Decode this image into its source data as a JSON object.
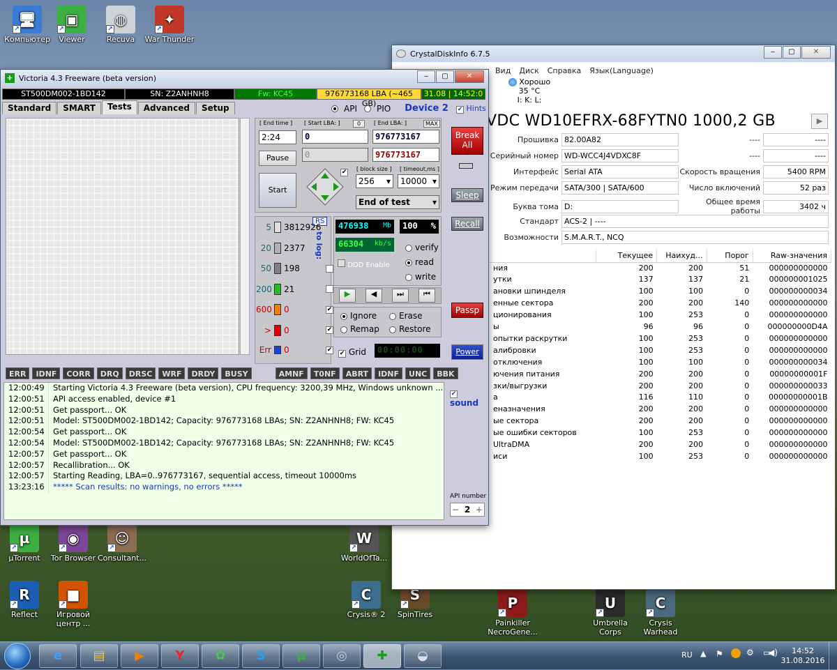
{
  "desktop_icons": [
    {
      "label": "Компьютер",
      "color": "#3a7bd5",
      "glyph": "🖥"
    },
    {
      "label": "Viewer",
      "color": "#3cb043",
      "glyph": "▣"
    },
    {
      "label": "Recuva",
      "color": "#cfd3d8",
      "glyph": "◍"
    },
    {
      "label": "War Thunder",
      "color": "#c0392b",
      "glyph": "✦"
    },
    {
      "label": "µTorrent",
      "color": "#3cb043",
      "glyph": "µ"
    },
    {
      "label": "Tor Browser",
      "color": "#7d4698",
      "glyph": "◉"
    },
    {
      "label": "Consultant...",
      "color": "#8c6d52",
      "glyph": "☺"
    },
    {
      "label": "WorldOfTa...",
      "color": "#555",
      "glyph": "W"
    },
    {
      "label": "Reflect",
      "color": "#1a5fb4",
      "glyph": "R"
    },
    {
      "label": "Игровой центр ...",
      "color": "#d35400",
      "glyph": "■"
    },
    {
      "label": "Crysis® 2",
      "color": "#3b6e8f",
      "glyph": "C"
    },
    {
      "label": "SpinTires",
      "color": "#6b4a2a",
      "glyph": "S"
    },
    {
      "label": "Painkiller NecroGene...",
      "color": "#8e1b1b",
      "glyph": "P"
    },
    {
      "label": "Umbrella Corps",
      "color": "#2b2b2b",
      "glyph": "U"
    },
    {
      "label": "Crysis Warhead",
      "color": "#4a6a7f",
      "glyph": "C"
    }
  ],
  "crystal": {
    "title": "CrystalDiskInfo 6.7.5",
    "menu": [
      "Вид",
      "Диск",
      "Справка",
      "Язык(Language)"
    ],
    "health": "Хорошо",
    "temp": "35 °C",
    "drives": "I: K: L:",
    "model": "VDC WD10EFRX-68FYTN0 1000,2 GB",
    "fields": [
      {
        "label": "Прошивка",
        "value": "82.00A82",
        "rlabel": "----",
        "rvalue": "----"
      },
      {
        "label": "Серийный номер",
        "value": "WD-WCC4J4VDXC8F",
        "rlabel": "----",
        "rvalue": "----"
      },
      {
        "label": "Интерфейс",
        "value": "Serial ATA",
        "rlabel": "Скорость вращения",
        "rvalue": "5400 RPM"
      },
      {
        "label": "Режим передачи",
        "value": "SATA/300 | SATA/600",
        "rlabel": "Число включений",
        "rvalue": "52 раз"
      },
      {
        "label": "Буква тома",
        "value": "D:",
        "rlabel": "Общее время работы",
        "rvalue": "3402 ч"
      }
    ],
    "standard_label": "Стандарт",
    "standard": "ACS-2 | ----",
    "features_label": "Возможности",
    "features": "S.M.A.R.T., NCQ",
    "table_headers": [
      "",
      "Текущее",
      "Наихуд...",
      "Порог",
      "Raw-значения"
    ],
    "table_rows": [
      [
        "ния",
        "200",
        "200",
        "51",
        "000000000000"
      ],
      [
        "утки",
        "137",
        "137",
        "21",
        "000000001025"
      ],
      [
        "ановки шпинделя",
        "100",
        "100",
        "0",
        "000000000034"
      ],
      [
        "енные сектора",
        "200",
        "200",
        "140",
        "000000000000"
      ],
      [
        "ционирования",
        "100",
        "253",
        "0",
        "000000000000"
      ],
      [
        "ы",
        "96",
        "96",
        "0",
        "000000000D4A"
      ],
      [
        "опытки раскрутки",
        "100",
        "253",
        "0",
        "000000000000"
      ],
      [
        "алибровки",
        "100",
        "253",
        "0",
        "000000000000"
      ],
      [
        "отключения",
        "100",
        "100",
        "0",
        "000000000034"
      ],
      [
        "ючения питания",
        "200",
        "200",
        "0",
        "00000000001F"
      ],
      [
        "зки/выгрузки",
        "200",
        "200",
        "0",
        "000000000033"
      ],
      [
        "а",
        "116",
        "110",
        "0",
        "00000000001B"
      ],
      [
        "еназначения",
        "200",
        "200",
        "0",
        "000000000000"
      ],
      [
        "ые сектора",
        "200",
        "200",
        "0",
        "000000000000"
      ],
      [
        "ые ошибки секторов",
        "100",
        "253",
        "0",
        "000000000000"
      ],
      [
        "UltraDMA",
        "200",
        "200",
        "0",
        "000000000000"
      ],
      [
        "иси",
        "100",
        "253",
        "0",
        "000000000000"
      ]
    ]
  },
  "victoria": {
    "title": "Victoria 4.3 Freeware (beta version)",
    "info": [
      "ST500DM002-1BD142",
      "SN: Z2ANHNH8",
      "Fw: KC45",
      "976773168 LBA (~465 GB)",
      "31.08 | 14:52:0"
    ],
    "tabs": [
      "Standard",
      "SMART",
      "Tests",
      "Advanced",
      "Setup"
    ],
    "api_label": "API",
    "pio_label": "PIO",
    "device": "Device 2",
    "hints": "Hints",
    "end_time_lbl": "[ End time ]",
    "end_time": "2:24",
    "start_lba_lbl": "[ Start LBA: ]",
    "start_lba_btn": "0",
    "start_lba": "0",
    "end_lba_lbl": "[ End LBA: ]",
    "end_lba_max": "MAX",
    "end_lba": "976773167",
    "cur_lba": "976773167",
    "zero_field": "0",
    "pause": "Pause",
    "start": "Start",
    "block_size_lbl": "[ block size ]",
    "block_size": "256",
    "timeout_lbl": "[ timeout,ms ]",
    "timeout": "10000",
    "mode": "End of test",
    "break_all": "Break All",
    "sleep": "Sleep",
    "recall": "Recall",
    "passp": "Passp",
    "power": "Power",
    "rs": "RS",
    "to_log": "to log:",
    "legend": [
      {
        "ms": "5",
        "count": "3812926",
        "color": "#e0e0e0"
      },
      {
        "ms": "20",
        "count": "2377",
        "color": "#b0b0b0"
      },
      {
        "ms": "50",
        "count": "198",
        "color": "#808080"
      },
      {
        "ms": "200",
        "count": "21",
        "color": "#22c022"
      },
      {
        "ms": "600",
        "count": "0",
        "color": "#f08000"
      },
      {
        "ms": ">",
        "count": "0",
        "color": "#e00000"
      },
      {
        "ms": "Err",
        "count": "0",
        "color": "#2040e0"
      }
    ],
    "mb": "476938",
    "mb_unit": "Mb",
    "pct": "100",
    "pct_unit": "%",
    "speed": "66304",
    "speed_unit": "kb/s",
    "verify": "verify",
    "read": "read",
    "write": "write",
    "ddd": "DDD Enable",
    "ignore": "Ignore",
    "erase": "Erase",
    "remap": "Remap",
    "restore": "Restore",
    "grid": "Grid",
    "timer": "00:00:00",
    "stats_left": [
      "ERR",
      "IDNF",
      "CORR",
      "DRQ",
      "DRSC",
      "WRF",
      "DRDY",
      "BUSY"
    ],
    "stats_right": [
      "AMNF",
      "T0NF",
      "ABRT",
      "IDNF",
      "UNC",
      "BBK"
    ],
    "sound": "sound",
    "api_number_lbl": "API number",
    "api_number": "2",
    "log": [
      {
        "t": "12:00:49",
        "m": "Starting Victoria 4.3 Freeware (beta version), CPU frequency: 3200,39 MHz, Windows unknown ..."
      },
      {
        "t": "12:00:51",
        "m": "API access enabled, device #1"
      },
      {
        "t": "12:00:51",
        "m": "Get passport... OK"
      },
      {
        "t": "12:00:51",
        "m": "Model: ST500DM002-1BD142; Capacity: 976773168 LBAs; SN: Z2ANHNH8; FW: KC45"
      },
      {
        "t": "12:00:54",
        "m": "Get passport... OK"
      },
      {
        "t": "12:00:54",
        "m": "Model: ST500DM002-1BD142; Capacity: 976773168 LBAs; SN: Z2ANHNH8; FW: KC45"
      },
      {
        "t": "12:00:57",
        "m": "Get passport... OK"
      },
      {
        "t": "12:00:57",
        "m": "Recallibration... OK"
      },
      {
        "t": "12:00:57",
        "m": "Starting Reading, LBA=0..976773167, sequential access, timeout 10000ms"
      },
      {
        "t": "13:23:16",
        "m": "***** Scan results: no warnings, no errors *****"
      }
    ]
  },
  "taskbar": {
    "lang": "RU",
    "time": "14:52",
    "date": "31.08.2016"
  }
}
